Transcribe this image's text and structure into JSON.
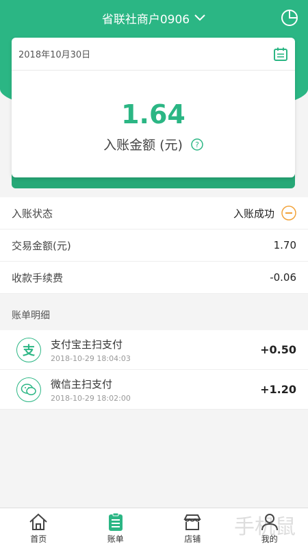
{
  "header": {
    "merchant_name": "省联社商户0906"
  },
  "card": {
    "date": "2018年10月30日",
    "amount": "1.64",
    "amount_label": "入账金额 (元)"
  },
  "info": {
    "status_label": "入账状态",
    "status_value": "入账成功",
    "trade_label": "交易金额(元)",
    "trade_value": "1.70",
    "fee_label": "收款手续费",
    "fee_value": "-0.06"
  },
  "section_title": "账单明细",
  "transactions": [
    {
      "name": "支付宝主扫支付",
      "time": "2018-10-29 18:04:03",
      "amount": "+0.50",
      "logo": "alipay-icon",
      "logo_glyph": "支"
    },
    {
      "name": "微信主扫支付",
      "time": "2018-10-29 18:02:00",
      "amount": "+1.20",
      "logo": "wechat-icon"
    }
  ],
  "tabs": [
    {
      "label": "首页",
      "icon": "home-icon"
    },
    {
      "label": "账单",
      "icon": "bill-icon",
      "active": true
    },
    {
      "label": "店铺",
      "icon": "store-icon"
    },
    {
      "label": "我的",
      "icon": "user-icon"
    }
  ],
  "watermark": "手机鼠",
  "colors": {
    "accent": "#2bb684",
    "accent_dark": "#27a877",
    "minus_orange": "#f2a33a"
  }
}
